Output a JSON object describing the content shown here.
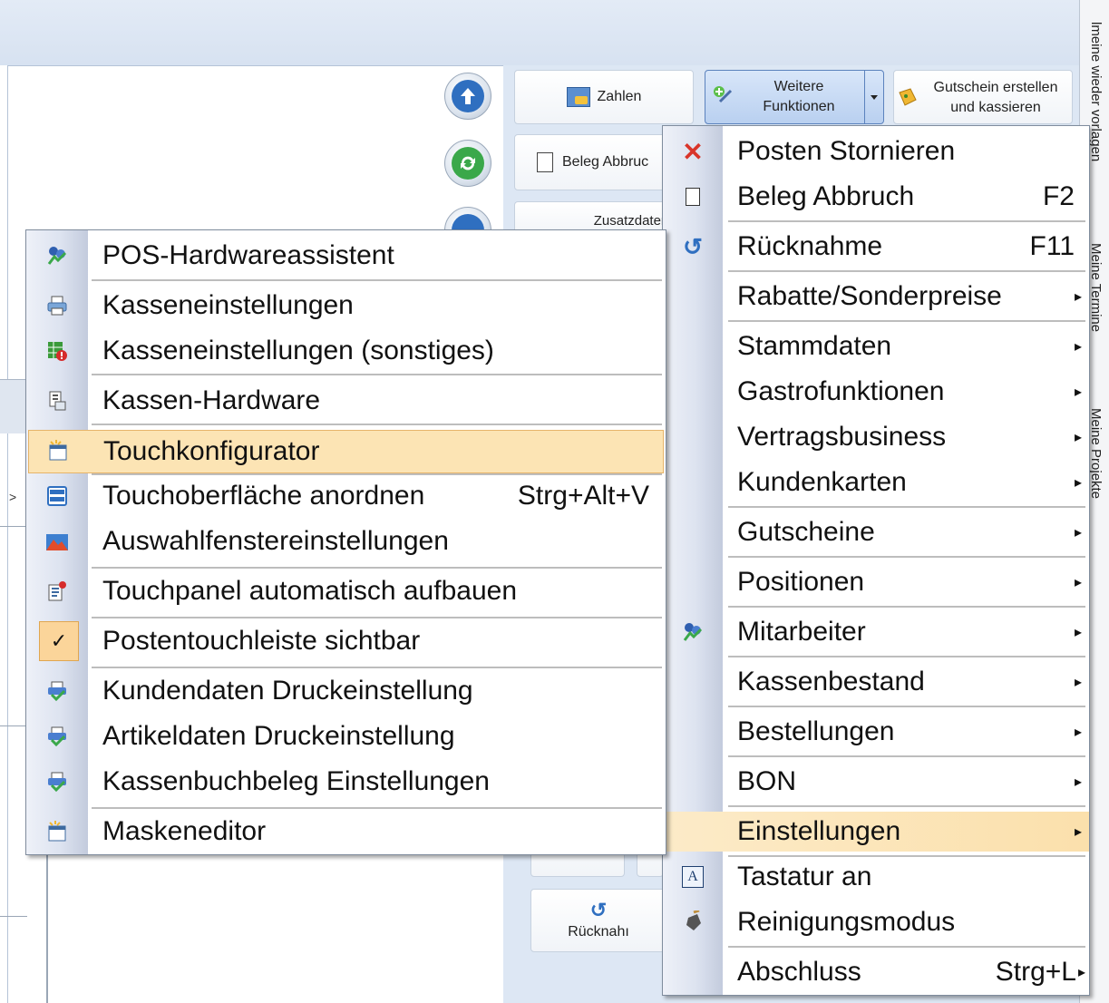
{
  "toolbar": {
    "zahlen": "Zahlen",
    "weitere_line1": "Weitere",
    "weitere_line2": "Funktionen",
    "gutschein_line1": "Gutschein erstellen",
    "gutschein_line2": "und kassieren",
    "beleg_abbruch": "Beleg Abbruc",
    "zusatzdaten": "Zusatzdaten",
    "ruecknahme": "Rücknahı"
  },
  "side_panel": {
    "tab1": "lmeine wieder vorlagen",
    "tab2": "Meine Termine",
    "tab3": "Meine Projekte"
  },
  "left_arrow": ">",
  "main_menu": {
    "items": [
      {
        "label": "Posten Stornieren",
        "shortcut": "",
        "icon": "cross-icon"
      },
      {
        "label": "Beleg Abbruch",
        "shortcut": "F2",
        "icon": "document-icon"
      },
      {
        "label": "Rücknahme",
        "shortcut": "F11",
        "icon": "refresh-icon"
      },
      {
        "label": "Rabatte/Sonderpreise",
        "shortcut": "",
        "icon": ""
      },
      {
        "label": "Stammdaten",
        "shortcut": "",
        "icon": ""
      },
      {
        "label": "Gastrofunktionen",
        "shortcut": "",
        "icon": ""
      },
      {
        "label": "Vertragsbusiness",
        "shortcut": "",
        "icon": ""
      },
      {
        "label": "Kundenkarten",
        "shortcut": "",
        "icon": ""
      },
      {
        "label": "Gutscheine",
        "shortcut": "",
        "icon": ""
      },
      {
        "label": "Positionen",
        "shortcut": "",
        "icon": ""
      },
      {
        "label": "Mitarbeiter",
        "shortcut": "",
        "icon": "users-icon"
      },
      {
        "label": "Kassenbestand",
        "shortcut": "",
        "icon": ""
      },
      {
        "label": "Bestellungen",
        "shortcut": "",
        "icon": ""
      },
      {
        "label": "BON",
        "shortcut": "",
        "icon": ""
      },
      {
        "label": "Einstellungen",
        "shortcut": "",
        "icon": ""
      },
      {
        "label": "Tastatur an",
        "shortcut": "",
        "icon": "keyboard-icon"
      },
      {
        "label": "Reinigungsmodus",
        "shortcut": "",
        "icon": "cleaning-icon"
      },
      {
        "label": "Abschluss",
        "shortcut": "Strg+L",
        "icon": ""
      }
    ]
  },
  "sub_menu": {
    "items": [
      {
        "label": "POS-Hardwareassistent",
        "shortcut": "",
        "icon": "users-icon"
      },
      {
        "label": "Kasseneinstellungen",
        "shortcut": "",
        "icon": "printer-icon"
      },
      {
        "label": "Kasseneinstellungen (sonstiges)",
        "shortcut": "",
        "icon": "table-alert-icon"
      },
      {
        "label": "Kassen-Hardware",
        "shortcut": "",
        "icon": "hardware-icon"
      },
      {
        "label": "Touchkonfigurator",
        "shortcut": "",
        "icon": "touch-config-icon"
      },
      {
        "label": "Touchoberfläche anordnen",
        "shortcut": "Strg+Alt+V",
        "icon": "layout-icon"
      },
      {
        "label": "Auswahlfenstereinstellungen",
        "shortcut": "",
        "icon": "selection-window-icon"
      },
      {
        "label": "Touchpanel automatisch aufbauen",
        "shortcut": "",
        "icon": "auto-build-icon"
      },
      {
        "label": "Postentouchleiste sichtbar",
        "shortcut": "",
        "icon": "check-icon"
      },
      {
        "label": "Kundendaten Druckeinstellung",
        "shortcut": "",
        "icon": "print-check-icon"
      },
      {
        "label": "Artikeldaten Druckeinstellung",
        "shortcut": "",
        "icon": "print-check-icon"
      },
      {
        "label": "Kassenbuchbeleg Einstellungen",
        "shortcut": "",
        "icon": "print-check-icon"
      },
      {
        "label": "Maskeneditor",
        "shortcut": "",
        "icon": "mask-editor-icon"
      }
    ]
  }
}
